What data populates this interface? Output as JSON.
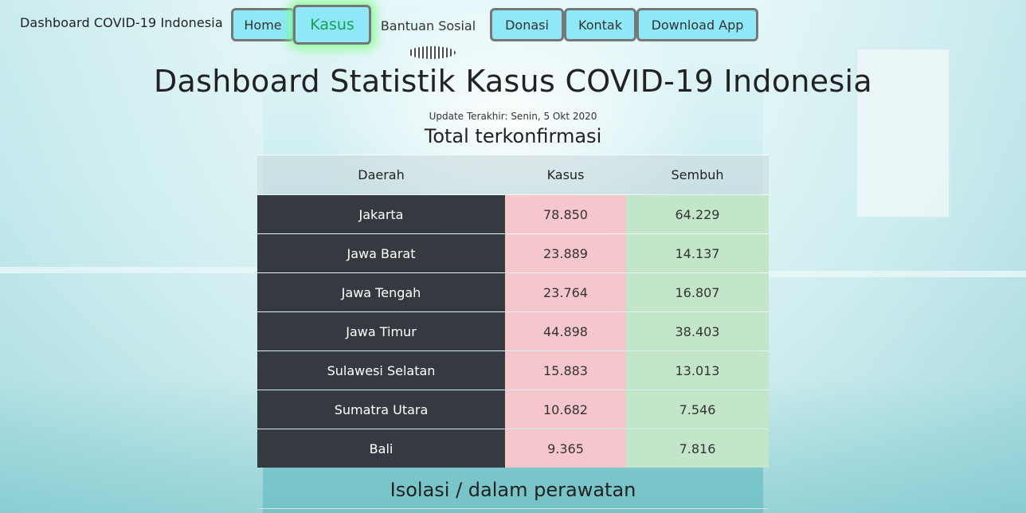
{
  "brand": "Dashboard COVID-19 Indonesia",
  "nav": [
    {
      "label": "Home",
      "active": false
    },
    {
      "label": "Kasus",
      "active": true
    },
    {
      "label": "Bantuan Sosial",
      "active": false
    },
    {
      "label": "Donasi",
      "active": false
    },
    {
      "label": "Kontak",
      "active": false
    },
    {
      "label": "Download App",
      "active": false
    }
  ],
  "page_title": "Dashboard Statistik Kasus COVID-19 Indonesia",
  "updated": "Update Terakhir: Senin, 5 Okt 2020",
  "section1_title": "Total terkonfirmasi",
  "table": {
    "headers": [
      "Daerah",
      "Kasus",
      "Sembuh"
    ],
    "rows": [
      [
        "Jakarta",
        "78.850",
        "64.229"
      ],
      [
        "Jawa Barat",
        "23.889",
        "14.137"
      ],
      [
        "Jawa Tengah",
        "23.764",
        "16.807"
      ],
      [
        "Jawa Timur",
        "44.898",
        "38.403"
      ],
      [
        "Sulawesi Selatan",
        "15.883",
        "13.013"
      ],
      [
        "Sumatra Utara",
        "10.682",
        "7.546"
      ],
      [
        "Bali",
        "9.365",
        "7.816"
      ]
    ]
  },
  "section2_title": "Isolasi / dalam perawatan",
  "colors": {
    "nav_bg": "#8ee8f8",
    "nav_active_text": "#1b9e55",
    "region_bg": "#343a40",
    "cases_bg": "#f5c6cb",
    "recovered_bg": "#c3e6cb"
  }
}
